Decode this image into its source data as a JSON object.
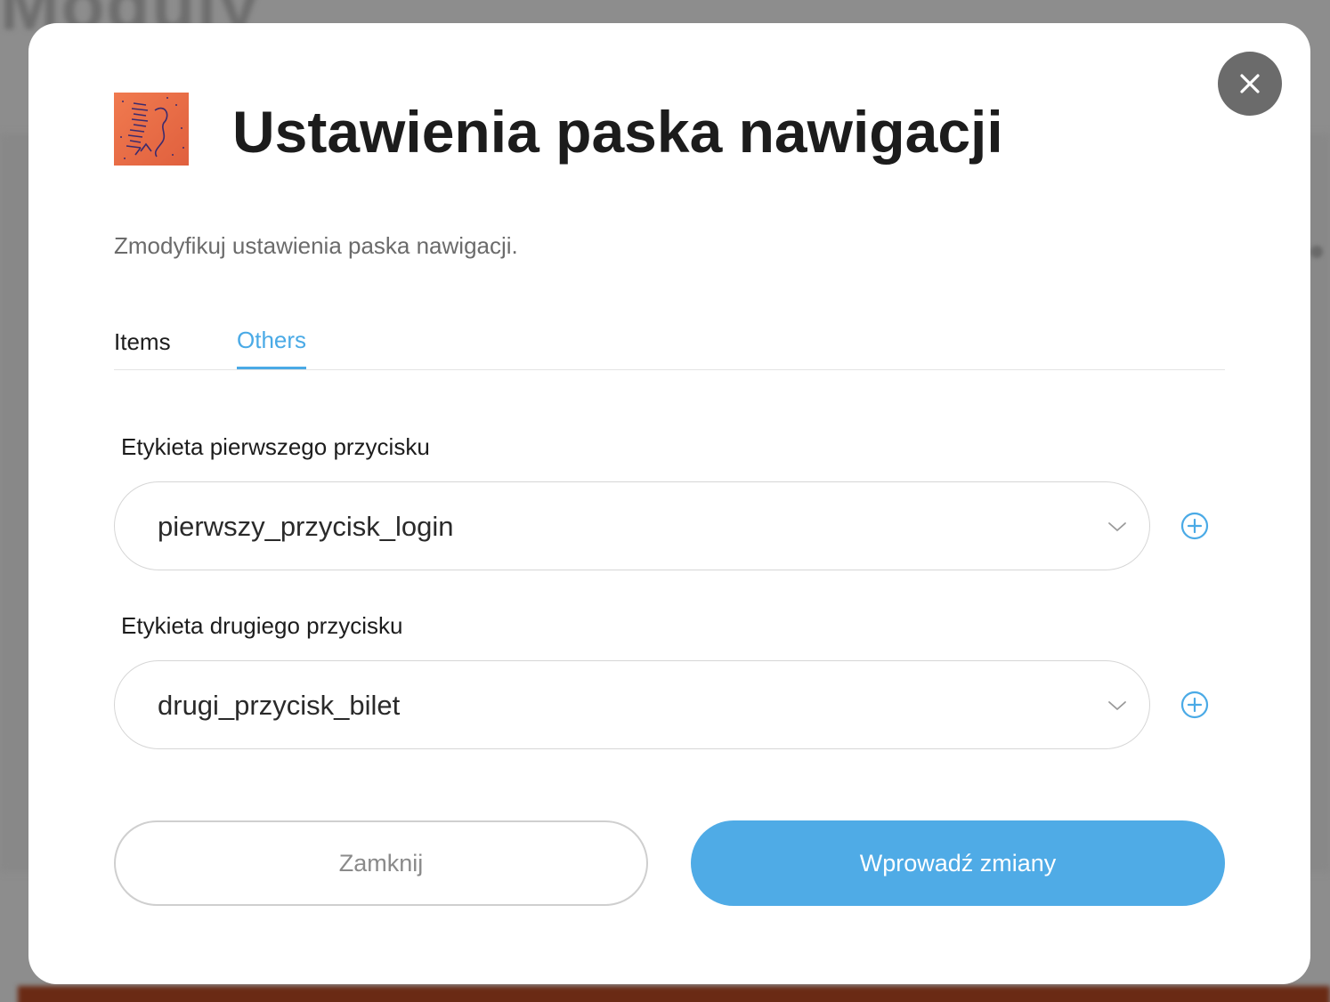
{
  "background": {
    "page_title": "Moduly"
  },
  "modal": {
    "title": "Ustawienia paska nawigacji",
    "subtitle": "Zmodyfikuj ustawienia paska nawigacji.",
    "logo_icon": "artwork-thumbnail",
    "close_icon": "close-icon",
    "tabs": [
      {
        "label": "Items",
        "active": false
      },
      {
        "label": "Others",
        "active": true
      }
    ],
    "fields": [
      {
        "label": "Etykieta pierwszego przycisku",
        "value": "pierwszy_przycisk_login"
      },
      {
        "label": "Etykieta drugiego przycisku",
        "value": "drugi_przycisk_bilet"
      }
    ],
    "buttons": {
      "close_label": "Zamknij",
      "submit_label": "Wprowadź zmiany"
    }
  },
  "colors": {
    "accent": "#4fabe6",
    "overlay": "#8d8d8d",
    "close_button_bg": "#6b6b6b"
  }
}
